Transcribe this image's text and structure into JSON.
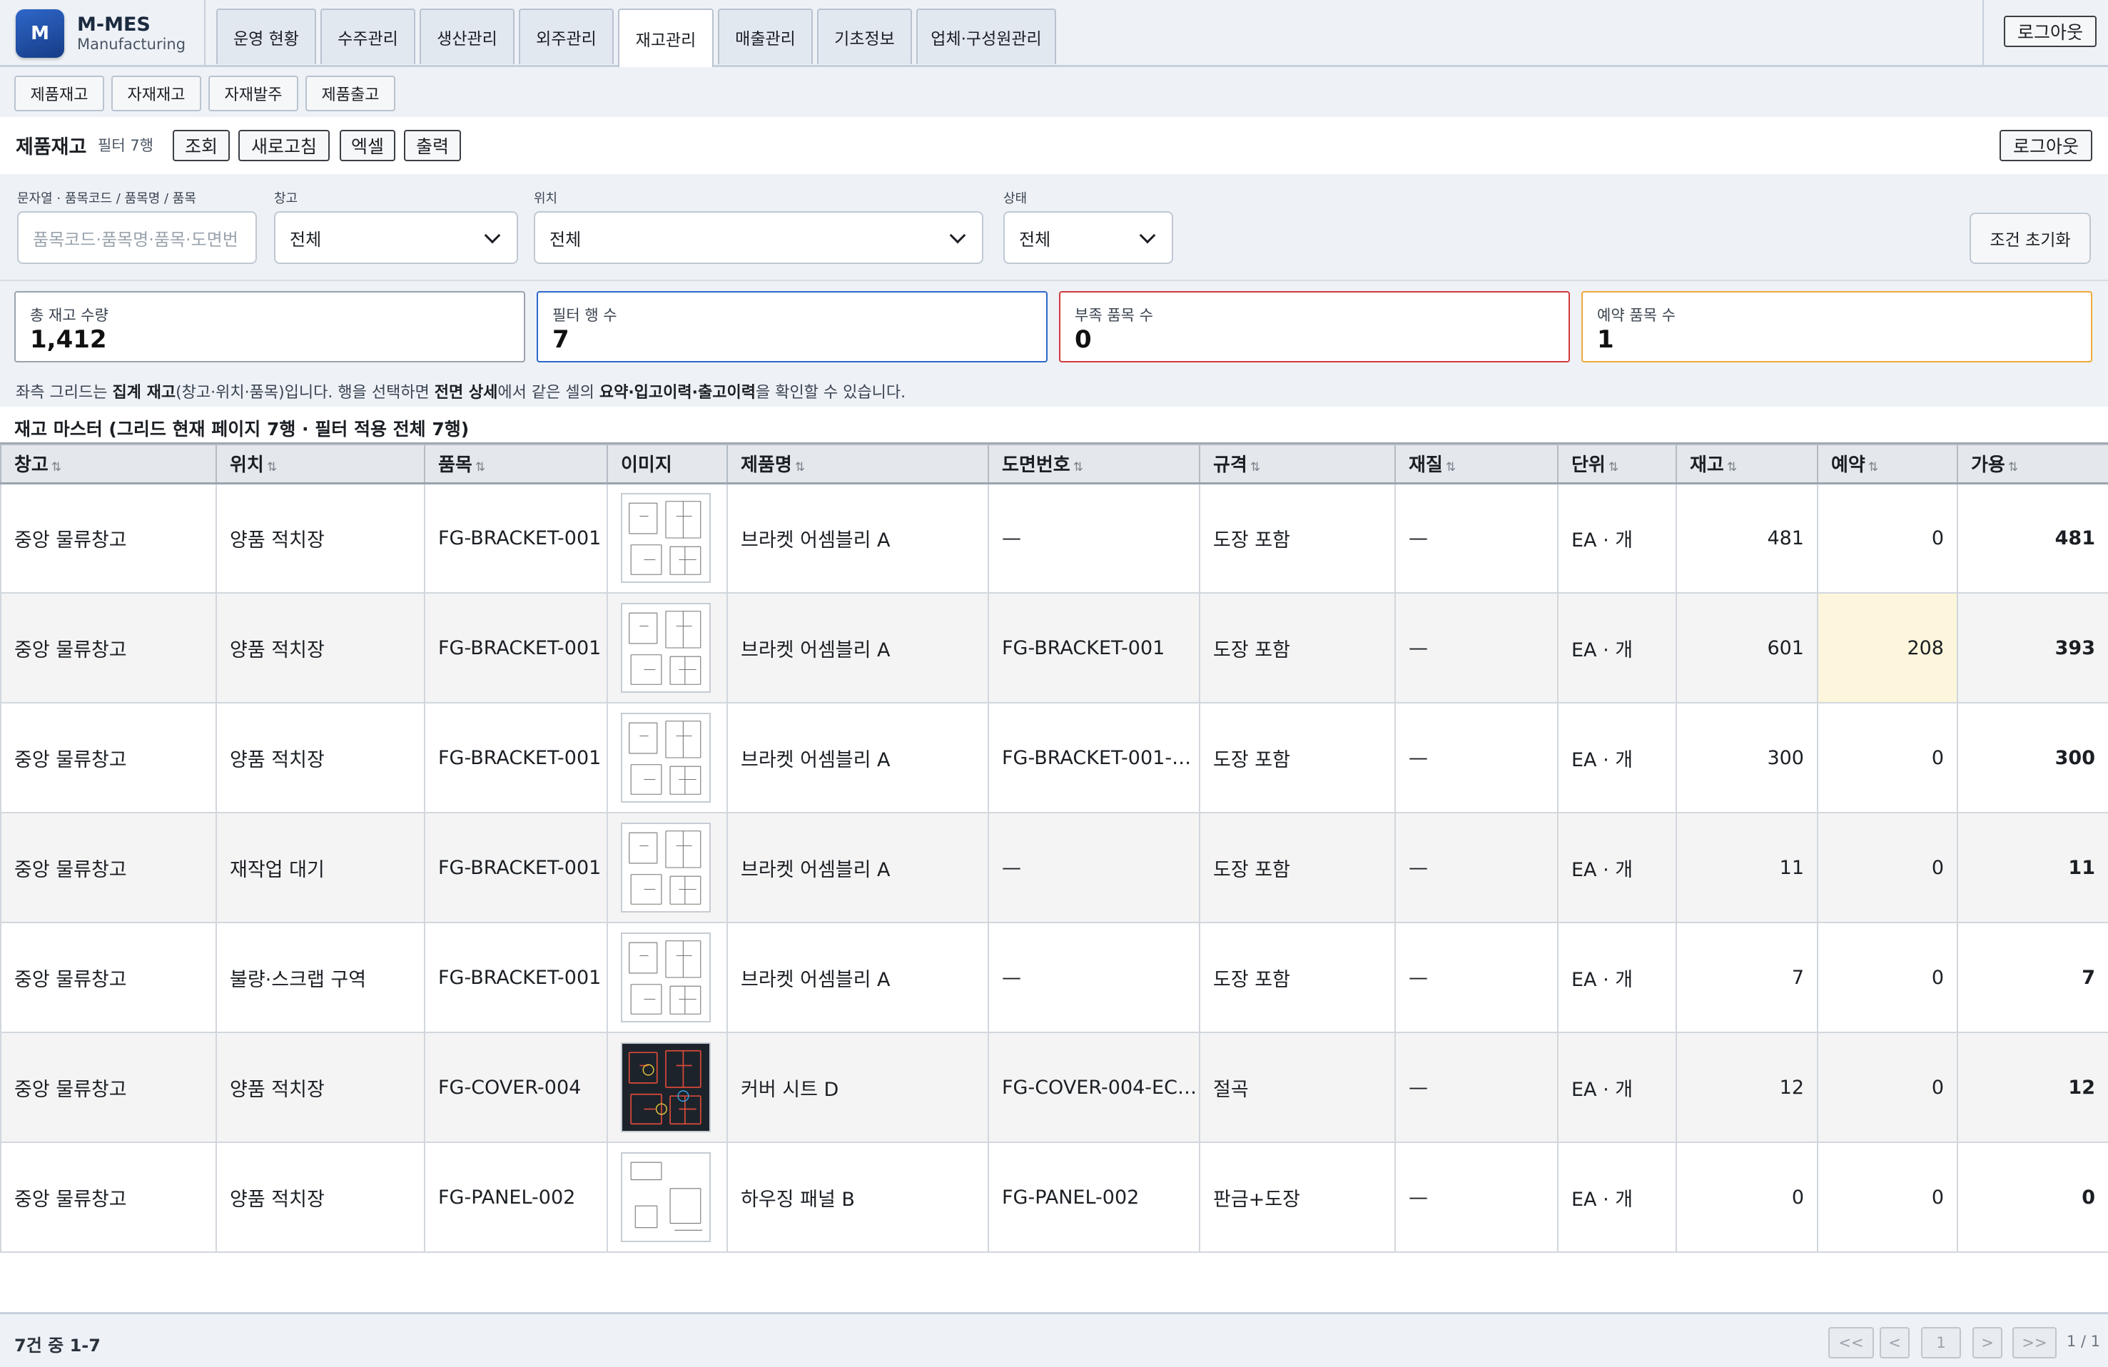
{
  "app": {
    "logo_letter": "M",
    "name": "M-MES",
    "subtitle": "Manufacturing"
  },
  "nav": {
    "tabs": [
      "운영 현황",
      "수주관리",
      "생산관리",
      "외주관리",
      "재고관리",
      "매출관리",
      "기초정보",
      "업체·구성원관리"
    ],
    "active": "재고관리",
    "logout": "로그아웃"
  },
  "subnav": {
    "tabs": [
      "제품재고",
      "자재재고",
      "자재발주",
      "제품출고"
    ]
  },
  "page": {
    "title": "제품재고",
    "filter_count": "필터 7행",
    "actions": [
      "조회",
      "새로고침",
      "엑셀",
      "출력"
    ],
    "logout": "로그아웃"
  },
  "filters": {
    "search": {
      "label": "문자열 · 품목코드 / 품목명 / 품목",
      "placeholder": "품목코드·품목명·품목·도면번"
    },
    "warehouse": {
      "label": "창고",
      "value": "전체"
    },
    "location": {
      "label": "위치",
      "value": "전체"
    },
    "status": {
      "label": "상태",
      "value": "전체"
    },
    "reset": "조건 초기화"
  },
  "kpis": [
    {
      "label": "총 재고 수량",
      "value": "1,412",
      "color": "#9aa3ad"
    },
    {
      "label": "필터 행 수",
      "value": "7",
      "color": "#2f67c9"
    },
    {
      "label": "부족 품목 수",
      "value": "0",
      "color": "#d23a3a"
    },
    {
      "label": "예약 품목 수",
      "value": "1",
      "color": "#f0a83a"
    }
  ],
  "info": {
    "p1": "좌측 그리드는 ",
    "b1": "집계 재고",
    "p2": "(창고·위치·품목)입니다. 행을 선택하면 ",
    "b2": "전면 상세",
    "p3": "에서 같은 셀의 ",
    "b3": "요약·입고이력·출고이력",
    "p4": "을 확인할 수 있습니다."
  },
  "grid": {
    "title": "재고 마스터 (그리드 현재 페이지 7행 · 필터 적용 전체 7행)",
    "sort_icon": "⇅",
    "columns": [
      "창고",
      "위치",
      "품목",
      "이미지",
      "제품명",
      "도면번호",
      "규격",
      "재질",
      "단위",
      "재고",
      "예약",
      "가용"
    ],
    "rows": [
      {
        "warehouse": "중앙 물류창고",
        "location": "양품 적치장",
        "item": "FG-BRACKET-001",
        "image": "drawing-light",
        "name": "브라켓 어셈블리 A",
        "drawing": "—",
        "spec": "도장 포함",
        "material": "—",
        "unit": "EA · 개",
        "stock": "481",
        "reserved": "0",
        "available": "481"
      },
      {
        "warehouse": "중앙 물류창고",
        "location": "양품 적치장",
        "item": "FG-BRACKET-001",
        "image": "drawing-light",
        "name": "브라켓 어셈블리 A",
        "drawing": "FG-BRACKET-001",
        "spec": "도장 포함",
        "material": "—",
        "unit": "EA · 개",
        "stock": "601",
        "reserved": "208",
        "available": "393"
      },
      {
        "warehouse": "중앙 물류창고",
        "location": "양품 적치장",
        "item": "FG-BRACKET-001",
        "image": "drawing-light",
        "name": "브라켓 어셈블리 A",
        "drawing": "FG-BRACKET-001-…",
        "spec": "도장 포함",
        "material": "—",
        "unit": "EA · 개",
        "stock": "300",
        "reserved": "0",
        "available": "300"
      },
      {
        "warehouse": "중앙 물류창고",
        "location": "재작업 대기",
        "item": "FG-BRACKET-001",
        "image": "drawing-light",
        "name": "브라켓 어셈블리 A",
        "drawing": "—",
        "spec": "도장 포함",
        "material": "—",
        "unit": "EA · 개",
        "stock": "11",
        "reserved": "0",
        "available": "11"
      },
      {
        "warehouse": "중앙 물류창고",
        "location": "불량·스크랩 구역",
        "item": "FG-BRACKET-001",
        "image": "drawing-light",
        "name": "브라켓 어셈블리 A",
        "drawing": "—",
        "spec": "도장 포함",
        "material": "—",
        "unit": "EA · 개",
        "stock": "7",
        "reserved": "0",
        "available": "7"
      },
      {
        "warehouse": "중앙 물류창고",
        "location": "양품 적치장",
        "item": "FG-COVER-004",
        "image": "drawing-dark",
        "name": "커버 시트 D",
        "drawing": "FG-COVER-004-EC…",
        "spec": "절곡",
        "material": "—",
        "unit": "EA · 개",
        "stock": "12",
        "reserved": "0",
        "available": "12"
      },
      {
        "warehouse": "중앙 물류창고",
        "location": "양품 적치장",
        "item": "FG-PANEL-002",
        "image": "drawing-sparse",
        "name": "하우징 패널 B",
        "drawing": "FG-PANEL-002",
        "spec": "판금+도장",
        "material": "—",
        "unit": "EA · 개",
        "stock": "0",
        "reserved": "0",
        "available": "0"
      }
    ]
  },
  "footer": {
    "count": "7건 중 1-7",
    "pager": [
      "<<",
      "<",
      "1",
      ">",
      ">>"
    ],
    "page_of": "1 / 1"
  }
}
